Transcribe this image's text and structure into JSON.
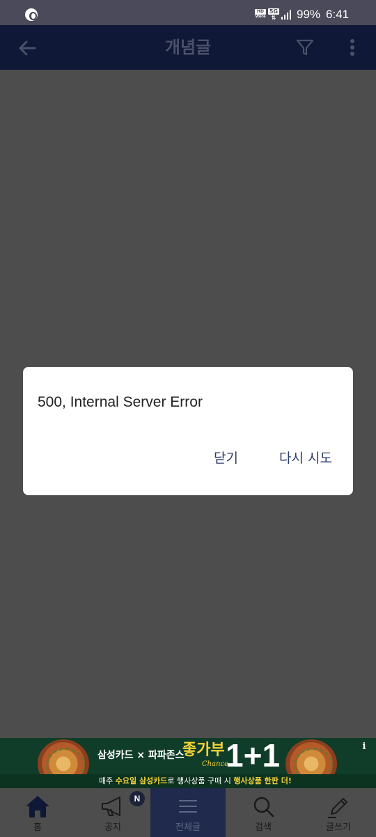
{
  "status_bar": {
    "hd_label": "HD",
    "voice_label": "Voice",
    "network_label": "5G",
    "battery": "99%",
    "time": "6:41"
  },
  "header": {
    "title": "개념글",
    "back_icon": "arrow-left-icon",
    "filter_icon": "filter-icon",
    "more_icon": "more-vertical-icon"
  },
  "dialog": {
    "message": "500, Internal Server Error",
    "close_label": "닫기",
    "retry_label": "다시 시도"
  },
  "ad": {
    "headline": "삼성카드 × 파파존스",
    "chance_text": "좋가부",
    "chance_sub": "Chance",
    "big_text": "1+1",
    "subline_pre": "매주 ",
    "subline_day": "수요일 삼성카드",
    "subline_mid": "로 행사상품 구매 시 ",
    "subline_end": "행사상품 한판 더!",
    "info_label": "i"
  },
  "bottom_nav": {
    "items": [
      {
        "label": "홈",
        "icon": "home-icon"
      },
      {
        "label": "공지",
        "icon": "megaphone-icon",
        "badge": "N"
      },
      {
        "label": "전체글",
        "icon": "menu-icon",
        "active": true
      },
      {
        "label": "검색",
        "icon": "search-icon"
      },
      {
        "label": "글쓰기",
        "icon": "pencil-icon"
      }
    ]
  },
  "colors": {
    "header_bg": "#0f1836",
    "overlay": "#4d4d4d",
    "dialog_button": "#2d3a6b",
    "nav_active": "#202a4c",
    "ad_bg": "#103d29"
  }
}
